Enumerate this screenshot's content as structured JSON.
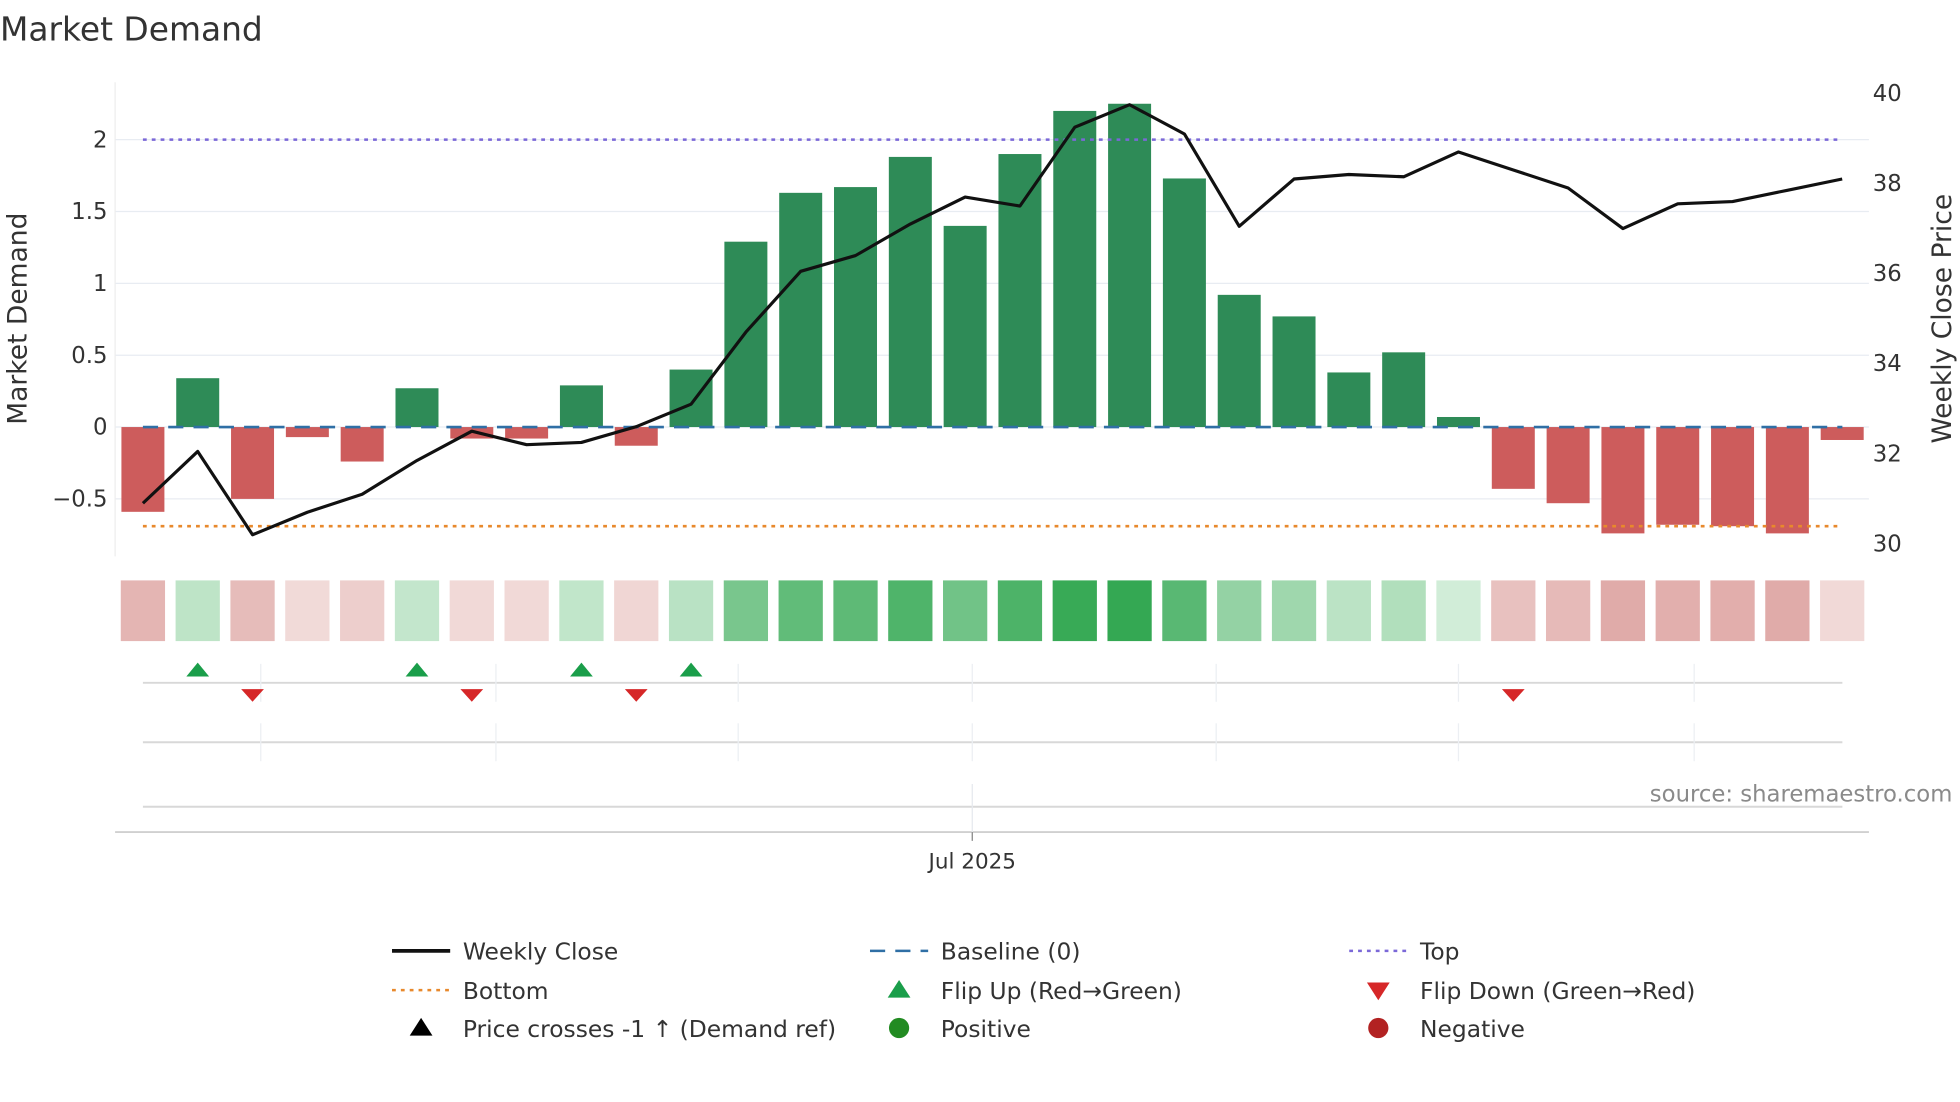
{
  "chart_data": {
    "type": "bar",
    "title": "Market Demand",
    "ylabel": "Market Demand",
    "y2label": "Weekly Close Price",
    "ylim": [
      -0.9,
      2.4
    ],
    "y2lim": [
      29.72,
      40.25
    ],
    "yticks": [
      -0.5,
      0,
      0.5,
      1,
      1.5,
      2
    ],
    "ytick_labels": [
      "−0.5",
      "0",
      "0.5",
      "1",
      "1.5",
      "2"
    ],
    "y2ticks": [
      30,
      32,
      34,
      36,
      38,
      40
    ],
    "y2tick_labels": [
      "30",
      "32",
      "34",
      "36",
      "38",
      "40"
    ],
    "demand": [
      -0.59,
      0.34,
      -0.5,
      -0.07,
      -0.24,
      0.27,
      -0.08,
      -0.08,
      0.29,
      -0.13,
      0.4,
      1.29,
      1.63,
      1.67,
      1.88,
      1.4,
      1.9,
      2.2,
      2.25,
      1.73,
      0.92,
      0.77,
      0.38,
      0.52,
      0.07,
      -0.43,
      -0.53,
      -0.74,
      -0.68,
      -0.69,
      -0.74,
      -0.09
    ],
    "weekly_close": [
      30.9,
      32.05,
      30.2,
      30.7,
      31.1,
      31.85,
      32.5,
      32.2,
      32.25,
      32.6,
      33.1,
      34.7,
      36.05,
      36.4,
      37.1,
      37.7,
      37.5,
      39.25,
      39.75,
      39.1,
      37.05,
      38.1,
      38.2,
      38.15,
      38.7,
      38.3,
      37.9,
      37.0,
      37.55,
      37.6,
      37.85,
      38.1
    ],
    "top": 2.0,
    "bottom": -0.69,
    "baseline": 0,
    "flip_up_weeks": [
      1,
      5,
      8,
      10
    ],
    "flip_down_weeks": [
      2,
      6,
      9,
      25
    ],
    "month_gridlines_week_index": [
      2.15,
      6.44,
      10.86,
      15.13,
      19.58,
      24.0,
      28.3
    ],
    "x_tick": {
      "week_index": 15.13,
      "label": "Jul 2025"
    },
    "legend": [
      {
        "label": "Weekly Close",
        "marker": "solid-line",
        "color": "#111111"
      },
      {
        "label": "Baseline (0)",
        "marker": "dashed-line",
        "color": "#2f6fa5"
      },
      {
        "label": "Top",
        "marker": "dotted-line",
        "color": "#7b68d8"
      },
      {
        "label": "Bottom",
        "marker": "dotted-line",
        "color": "#e8892c"
      },
      {
        "label": "Flip Up (Red→Green)",
        "marker": "triangle-up",
        "color": "#1a9e4a"
      },
      {
        "label": "Flip Down (Green→Red)",
        "marker": "triangle-down",
        "color": "#d62728"
      },
      {
        "label": "Price crosses -1 ↑ (Demand ref)",
        "marker": "triangle-up",
        "color": "#000000"
      },
      {
        "label": "Positive",
        "marker": "circle",
        "color": "#228b22"
      },
      {
        "label": "Negative",
        "marker": "circle",
        "color": "#b22222"
      }
    ],
    "colors": {
      "positive_bar": "#2e8b57",
      "negative_bar": "#cd5c5c",
      "grid": "#e8ecf2"
    },
    "source": "source: sharemaestro.com"
  }
}
